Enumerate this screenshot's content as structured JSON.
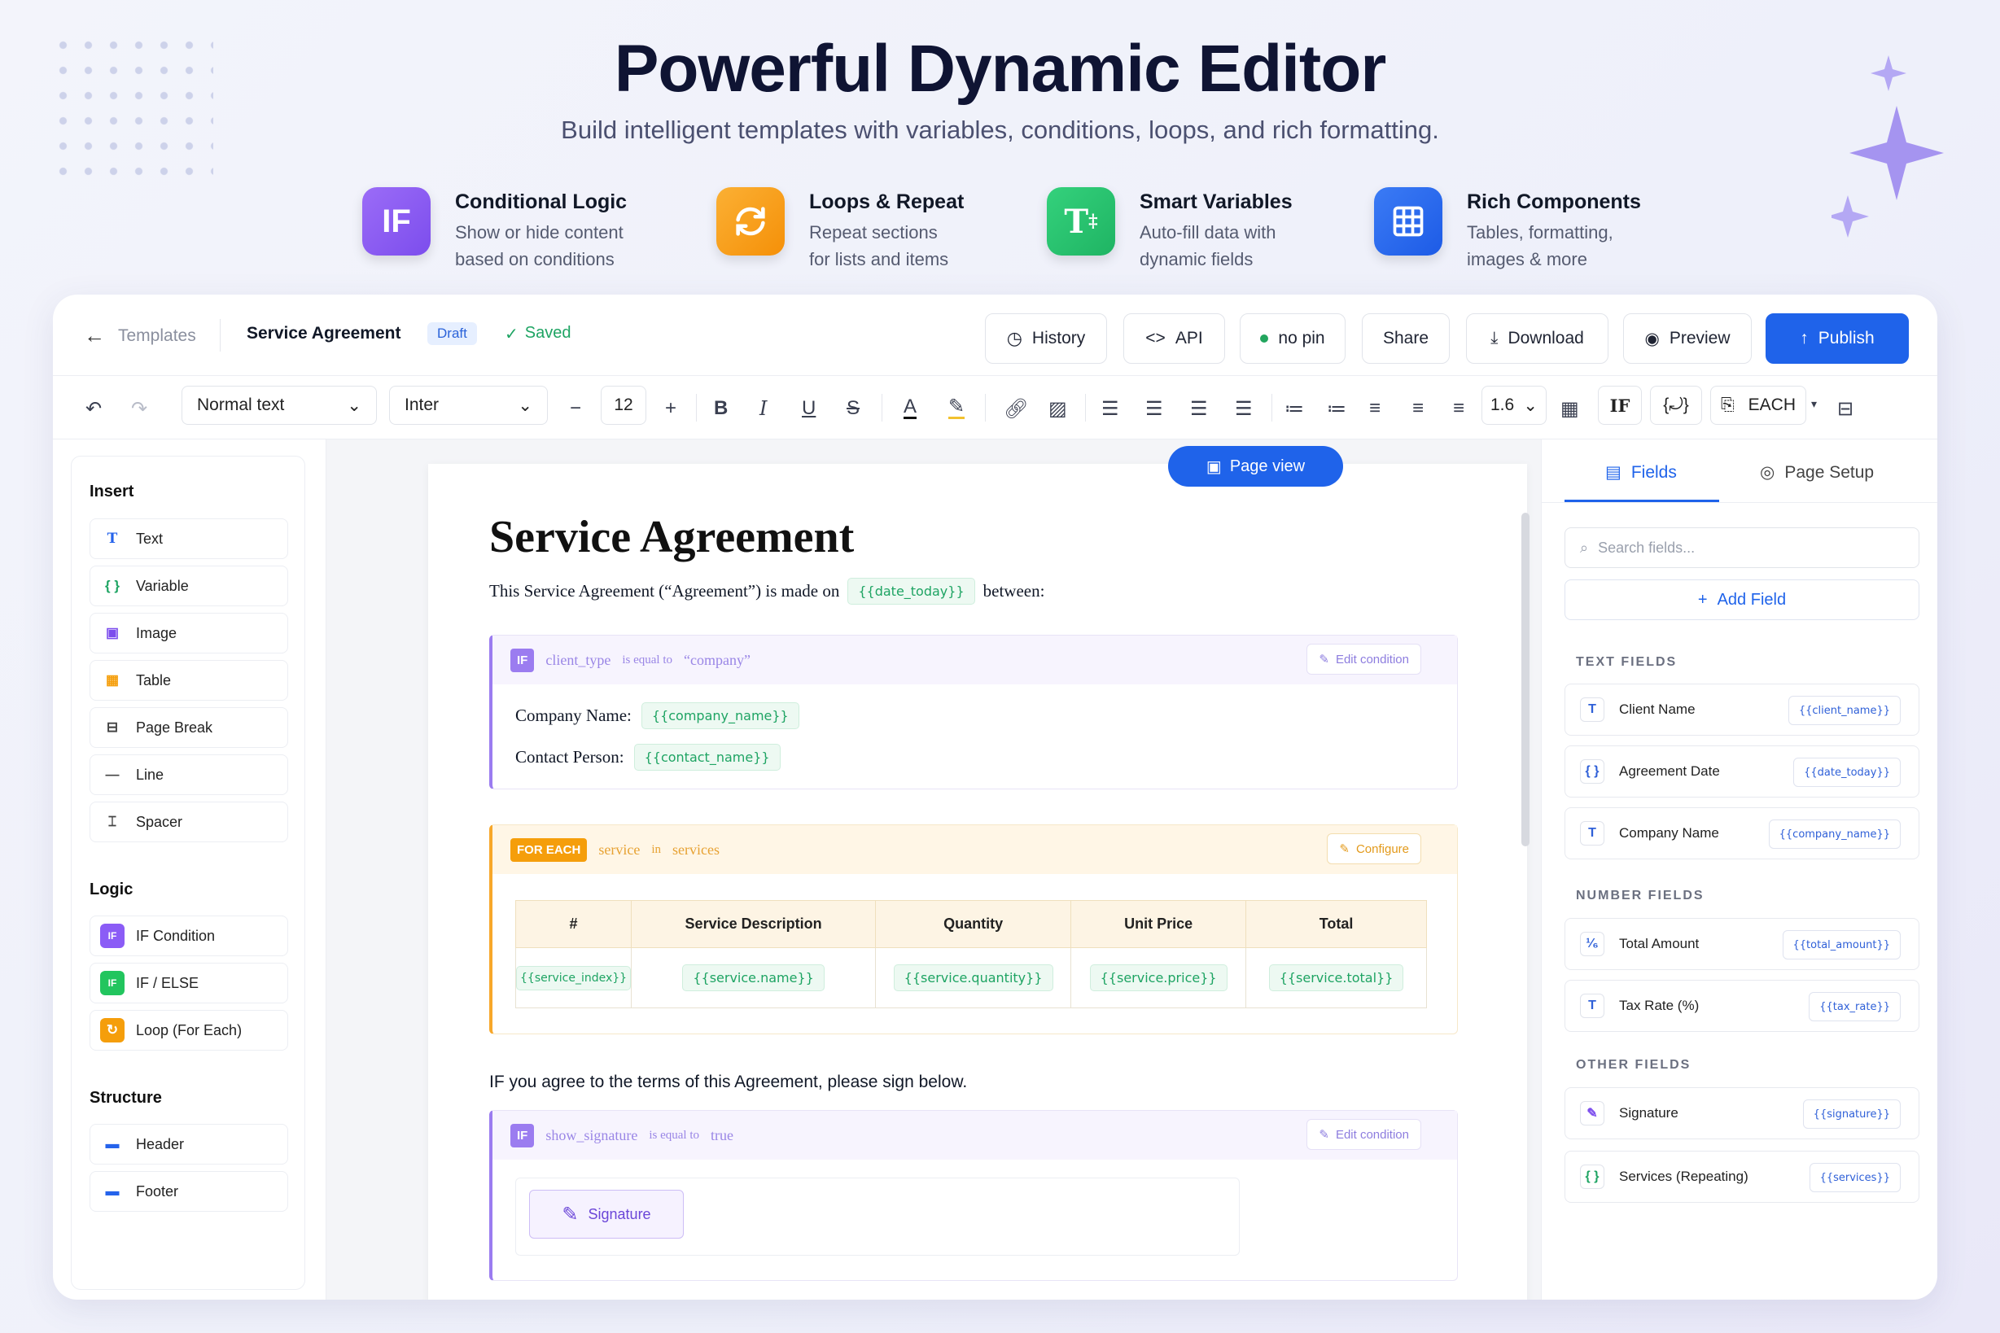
{
  "hero": {
    "title": "Powerful Dynamic Editor",
    "subtitle": "Build intelligent templates with variables, conditions, loops, and rich formatting."
  },
  "features": [
    {
      "icon": "IF",
      "title": "Conditional Logic",
      "line1": "Show or hide content",
      "line2": "based on conditions",
      "color": "#8b5cf6"
    },
    {
      "icon": "loop-icon",
      "title": "Loops & Repeat",
      "line1": "Repeat sections",
      "line2": "for lists and items",
      "color": "#f59e0b"
    },
    {
      "icon": "variable-icon",
      "title": "Smart Variables",
      "line1": "Auto-fill data with",
      "line2": "dynamic fields",
      "color": "#22c55e"
    },
    {
      "icon": "table-icon",
      "title": "Rich Components",
      "line1": "Tables, formatting,",
      "line2": "images & more",
      "color": "#2563eb"
    }
  ],
  "topbar": {
    "back": "Templates",
    "doc_title": "Service Agreement",
    "status": "Draft",
    "saved": "Saved",
    "history": "History",
    "api": "API",
    "pin": "no pin",
    "share": "Share",
    "download": "Download",
    "preview": "Preview",
    "publish": "Publish"
  },
  "toolbar": {
    "style": "Normal text",
    "font": "Inter",
    "size": "12",
    "line_height": "1.6",
    "if": "IF",
    "each": "EACH"
  },
  "sidebar": {
    "insert_heading": "Insert",
    "insert": [
      {
        "label": "Text",
        "icon": "T"
      },
      {
        "label": "Variable",
        "icon": "{ }"
      },
      {
        "label": "Image",
        "icon": "▣"
      },
      {
        "label": "Table",
        "icon": "▦"
      },
      {
        "label": "Page Break",
        "icon": "⊟"
      },
      {
        "label": "Line",
        "icon": "—"
      },
      {
        "label": "Spacer",
        "icon": "⌶"
      }
    ],
    "logic_heading": "Logic",
    "logic": [
      {
        "label": "IF Condition",
        "icon": "IF"
      },
      {
        "label": "IF / ELSE",
        "icon": "IF"
      },
      {
        "label": "Loop (For Each)",
        "icon": "↻"
      }
    ],
    "structure_heading": "Structure",
    "structure": [
      {
        "label": "Header",
        "icon": "▬"
      },
      {
        "label": "Footer",
        "icon": "▬"
      }
    ]
  },
  "document": {
    "page_view": "Page view",
    "title": "Service Agreement",
    "intro_before": "This Service Agreement (“Agreement”) is made on",
    "intro_var": "{{date_today}}",
    "intro_after": "between:",
    "cond1": {
      "tag": "IF",
      "field": "client_type",
      "op": "is equal to",
      "value": "“company”",
      "edit": "Edit condition"
    },
    "company_label": "Company Name:",
    "company_var": "{{company_name}}",
    "contact_label": "Contact Person:",
    "contact_var": "{{contact_name}}",
    "loop": {
      "tag": "FOR EACH",
      "item": "service",
      "in": "in",
      "list": "services",
      "configure": "Configure"
    },
    "table_headers": [
      "#",
      "Service Description",
      "Quantity",
      "Unit Price",
      "Total"
    ],
    "table_row": [
      "{{service_index}}",
      "{{service.name}}",
      "{{service.quantity}}",
      "{{service.price}}",
      "{{service.total}}"
    ],
    "agree": "IF you agree to the terms of this Agreement, please sign below.",
    "cond2": {
      "tag": "IF",
      "field": "show_signature",
      "op": "is equal to",
      "value": "true",
      "edit": "Edit condition"
    },
    "signature": "Signature"
  },
  "right": {
    "tab_fields": "Fields",
    "tab_setup": "Page Setup",
    "search_placeholder": "Search fields...",
    "add_field": "Add Field",
    "text_heading": "TEXT FIELDS",
    "text_fields": [
      {
        "label": "Client Name",
        "var": "{{client_name}}",
        "icon": "T"
      },
      {
        "label": "Agreement Date",
        "var": "{{date_today}}",
        "icon": "{ }"
      },
      {
        "label": "Company Name",
        "var": "{{company_name}}",
        "icon": "T"
      }
    ],
    "number_heading": "NUMBER FIELDS",
    "number_fields": [
      {
        "label": "Total Amount",
        "var": "{{total_amount}}",
        "icon": "¹⁄₆"
      },
      {
        "label": "Tax Rate (%)",
        "var": "{{tax_rate}}",
        "icon": "T"
      }
    ],
    "other_heading": "OTHER FIELDS",
    "other_fields": [
      {
        "label": "Signature",
        "var": "{{signature}}",
        "icon": "✎"
      },
      {
        "label": "Services (Repeating)",
        "var": "{{services}}",
        "icon": "{ }"
      }
    ]
  },
  "colors": {
    "accent": "#2563eb",
    "purple": "#8b5cf6",
    "orange": "#f59e0b",
    "green": "#22c55e"
  }
}
